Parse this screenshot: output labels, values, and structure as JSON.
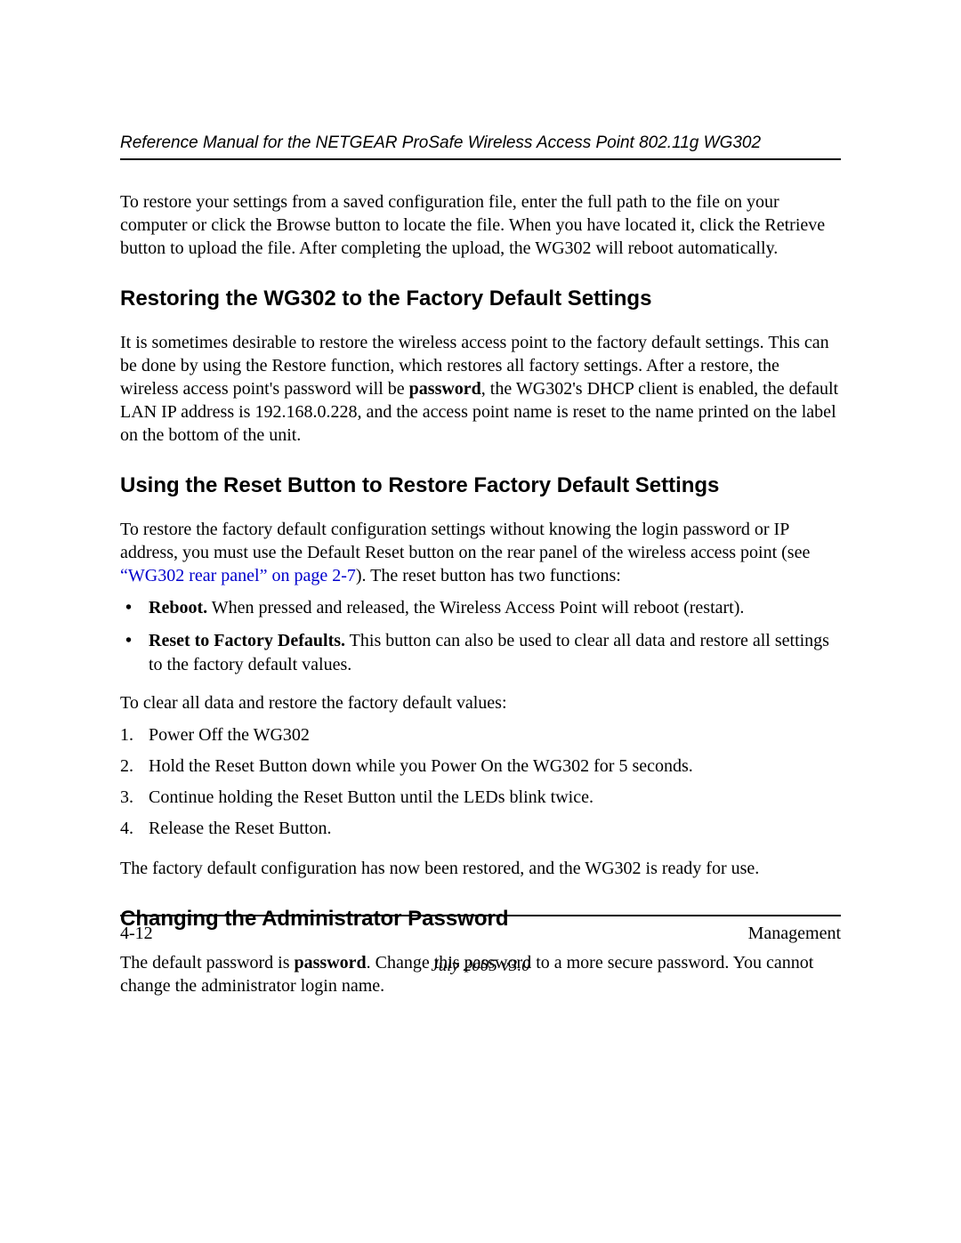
{
  "header": {
    "title": "Reference Manual for the NETGEAR ProSafe Wireless Access Point 802.11g WG302"
  },
  "intro_paragraph": "To restore your settings from a saved configuration file, enter the full path to the file on your computer or click the Browse button to locate the file. When you have located it, click the Retrieve button to upload the file. After completing the upload, the WG302 will reboot automatically.",
  "section1": {
    "heading": "Restoring the WG302 to the Factory Default Settings",
    "para_part1": "It is sometimes desirable to restore the wireless access point to the factory default settings. This can be done by using the Restore function, which restores all factory settings. After a restore, the wireless access point's password will be ",
    "bold_word": "password",
    "para_part2": ", the WG302's DHCP client is enabled, the default LAN IP address is 192.168.0.228, and the access point name is reset to the name printed on the label on the bottom of the unit."
  },
  "section2": {
    "heading": "Using the Reset Button to Restore Factory Default Settings",
    "para_part1": "To restore the factory default configuration settings without knowing the login password or IP address, you must use the Default Reset button on the rear panel of the wireless access point (see ",
    "link_text": "“WG302 rear panel” on page 2-7",
    "para_part2": "). The reset button has two functions:",
    "bullets": [
      {
        "label": "Reboot.",
        "rest": "  When pressed and released, the Wireless Access Point will reboot (restart)."
      },
      {
        "label": "Reset to Factory Defaults.",
        "rest": "  This button can also be used to clear all data and restore all settings to the factory default values."
      }
    ],
    "clear_intro": "To clear all data and restore the factory default values:",
    "steps": [
      "Power Off the WG302",
      "Hold the Reset Button down while you Power On the WG302 for 5 seconds.",
      "Continue holding the Reset Button until the LEDs blink twice.",
      "Release the Reset Button."
    ],
    "closing": "The factory default configuration has now been restored, and the WG302 is ready for use."
  },
  "section3": {
    "heading": "Changing the Administrator Password",
    "para_part1": "The default password is ",
    "bold_word": "password",
    "para_part2": ". Change this password to a more secure password. You cannot change the administrator login name."
  },
  "footer": {
    "page_num": "4-12",
    "section_name": "Management",
    "date_version": "July 2005 v3.0"
  }
}
